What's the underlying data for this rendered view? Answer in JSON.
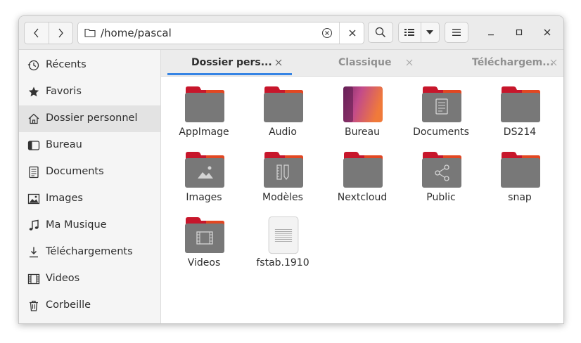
{
  "header": {
    "path": "/home/pascal",
    "back_icon": "chevron-left-icon",
    "forward_icon": "chevron-right-icon",
    "search_icon": "search-icon",
    "menu_icon": "hamburger-menu-icon"
  },
  "sidebar": {
    "items": [
      {
        "label": "Récents",
        "icon": "clock-icon"
      },
      {
        "label": "Favoris",
        "icon": "star-icon"
      },
      {
        "label": "Dossier personnel",
        "icon": "home-icon"
      },
      {
        "label": "Bureau",
        "icon": "desktop-icon"
      },
      {
        "label": "Documents",
        "icon": "document-icon"
      },
      {
        "label": "Images",
        "icon": "image-icon"
      },
      {
        "label": "Ma Musique",
        "icon": "music-icon"
      },
      {
        "label": "Téléchargements",
        "icon": "download-icon"
      },
      {
        "label": "Videos",
        "icon": "video-icon"
      },
      {
        "label": "Corbeille",
        "icon": "trash-icon"
      }
    ],
    "active_index": 2
  },
  "tabs": [
    {
      "label": "Dossier pers...",
      "active": true
    },
    {
      "label": "Classique",
      "active": false
    },
    {
      "label": "Téléchargem...",
      "active": false
    }
  ],
  "files": [
    {
      "name": "AppImage",
      "kind": "folder"
    },
    {
      "name": "Audio",
      "kind": "folder"
    },
    {
      "name": "Bureau",
      "kind": "desktop-folder"
    },
    {
      "name": "Documents",
      "kind": "documents-folder"
    },
    {
      "name": "DS214",
      "kind": "folder"
    },
    {
      "name": "Images",
      "kind": "pictures-folder"
    },
    {
      "name": "Modèles",
      "kind": "templates-folder"
    },
    {
      "name": "Nextcloud",
      "kind": "folder"
    },
    {
      "name": "Public",
      "kind": "public-folder"
    },
    {
      "name": "snap",
      "kind": "folder"
    },
    {
      "name": "Videos",
      "kind": "videos-folder"
    },
    {
      "name": "fstab.1910",
      "kind": "text-file"
    }
  ],
  "colors": {
    "accent": "#3584e4",
    "folder_body": "#787878",
    "folder_tab": "#c7162b",
    "folder_tab_orange": "#e95420"
  }
}
